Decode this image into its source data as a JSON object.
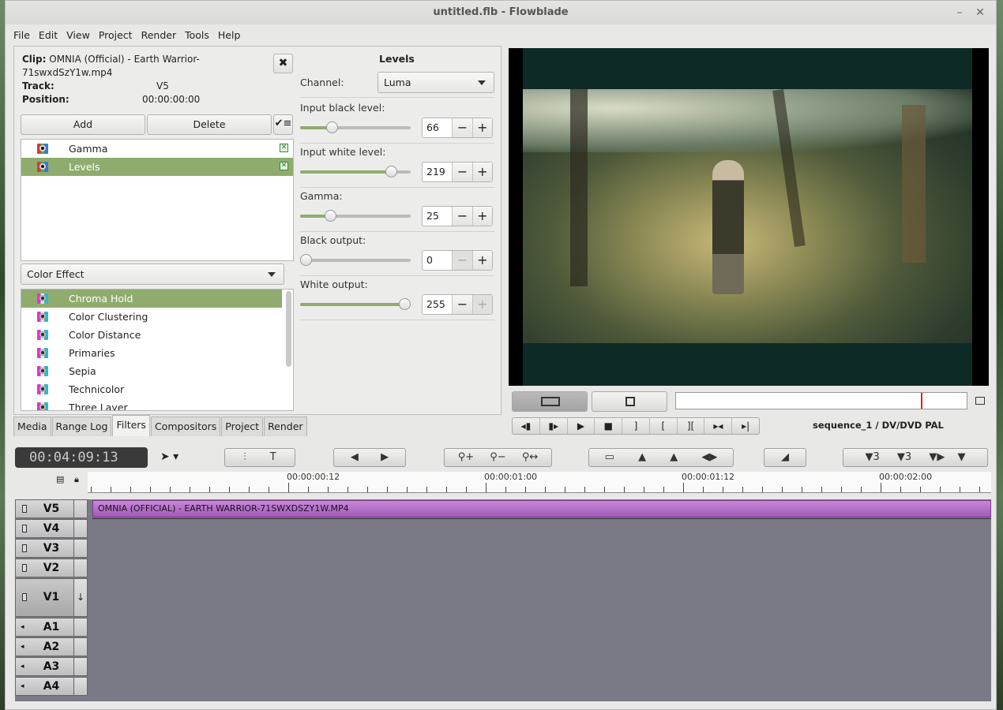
{
  "window": {
    "title": "untitled.flb - Flowblade",
    "minimize": "–",
    "close": "✕"
  },
  "menu": [
    "File",
    "Edit",
    "View",
    "Project",
    "Render",
    "Tools",
    "Help"
  ],
  "clip_info": {
    "clip_label": "Clip:",
    "clip_value": "OMNIA (Official) - Earth Warrior-71swxdSzY1w.mp4",
    "track_label": "Track:",
    "track_value": "V5",
    "position_label": "Position:",
    "position_value": "00:00:00:00"
  },
  "filter_buttons": {
    "add": "Add",
    "delete": "Delete"
  },
  "applied_filters": [
    {
      "name": "Gamma",
      "selected": false
    },
    {
      "name": "Levels",
      "selected": true
    }
  ],
  "filter_group": "Color Effect",
  "filter_library": [
    {
      "name": "Chroma Hold",
      "selected": true
    },
    {
      "name": "Color Clustering",
      "selected": false
    },
    {
      "name": "Color Distance",
      "selected": false
    },
    {
      "name": "Primaries",
      "selected": false
    },
    {
      "name": "Sepia",
      "selected": false
    },
    {
      "name": "Technicolor",
      "selected": false
    },
    {
      "name": "Three Layer",
      "selected": false
    }
  ],
  "tabs": [
    "Media",
    "Range Log",
    "Filters",
    "Compositors",
    "Project",
    "Render"
  ],
  "active_tab": "Filters",
  "levels": {
    "title": "Levels",
    "channel_label": "Channel:",
    "channel_value": "Luma",
    "params": [
      {
        "label": "Input black level:",
        "value": "66",
        "fraction": 0.26
      },
      {
        "label": "Input white level:",
        "value": "219",
        "fraction": 0.86
      },
      {
        "label": "Gamma:",
        "value": "25",
        "fraction": 0.25
      },
      {
        "label": "Black output:",
        "value": "0",
        "fraction": 0.0
      },
      {
        "label": "White output:",
        "value": "255",
        "fraction": 1.0
      }
    ],
    "minus": "−",
    "plus": "+"
  },
  "monitor": {
    "sequence_label": "sequence_1 / DV/DVD PAL"
  },
  "timeline": {
    "timecode": "00:04:09:13",
    "ruler_labels": [
      "00:00:00:12",
      "00:00:01:00",
      "00:00:01:12",
      "00:00:02:00"
    ],
    "clip_name": "OMNIA (OFFICIAL) - EARTH WARRIOR-71SWXDSZY1W.MP4",
    "tracks": [
      "V5",
      "V4",
      "V3",
      "V2",
      "V1",
      "A1",
      "A2",
      "A3",
      "A4"
    ]
  },
  "colors": {
    "selection": "#8fac6e",
    "clip": "#b06ac8",
    "timeline_bg": "#7a7a86"
  }
}
